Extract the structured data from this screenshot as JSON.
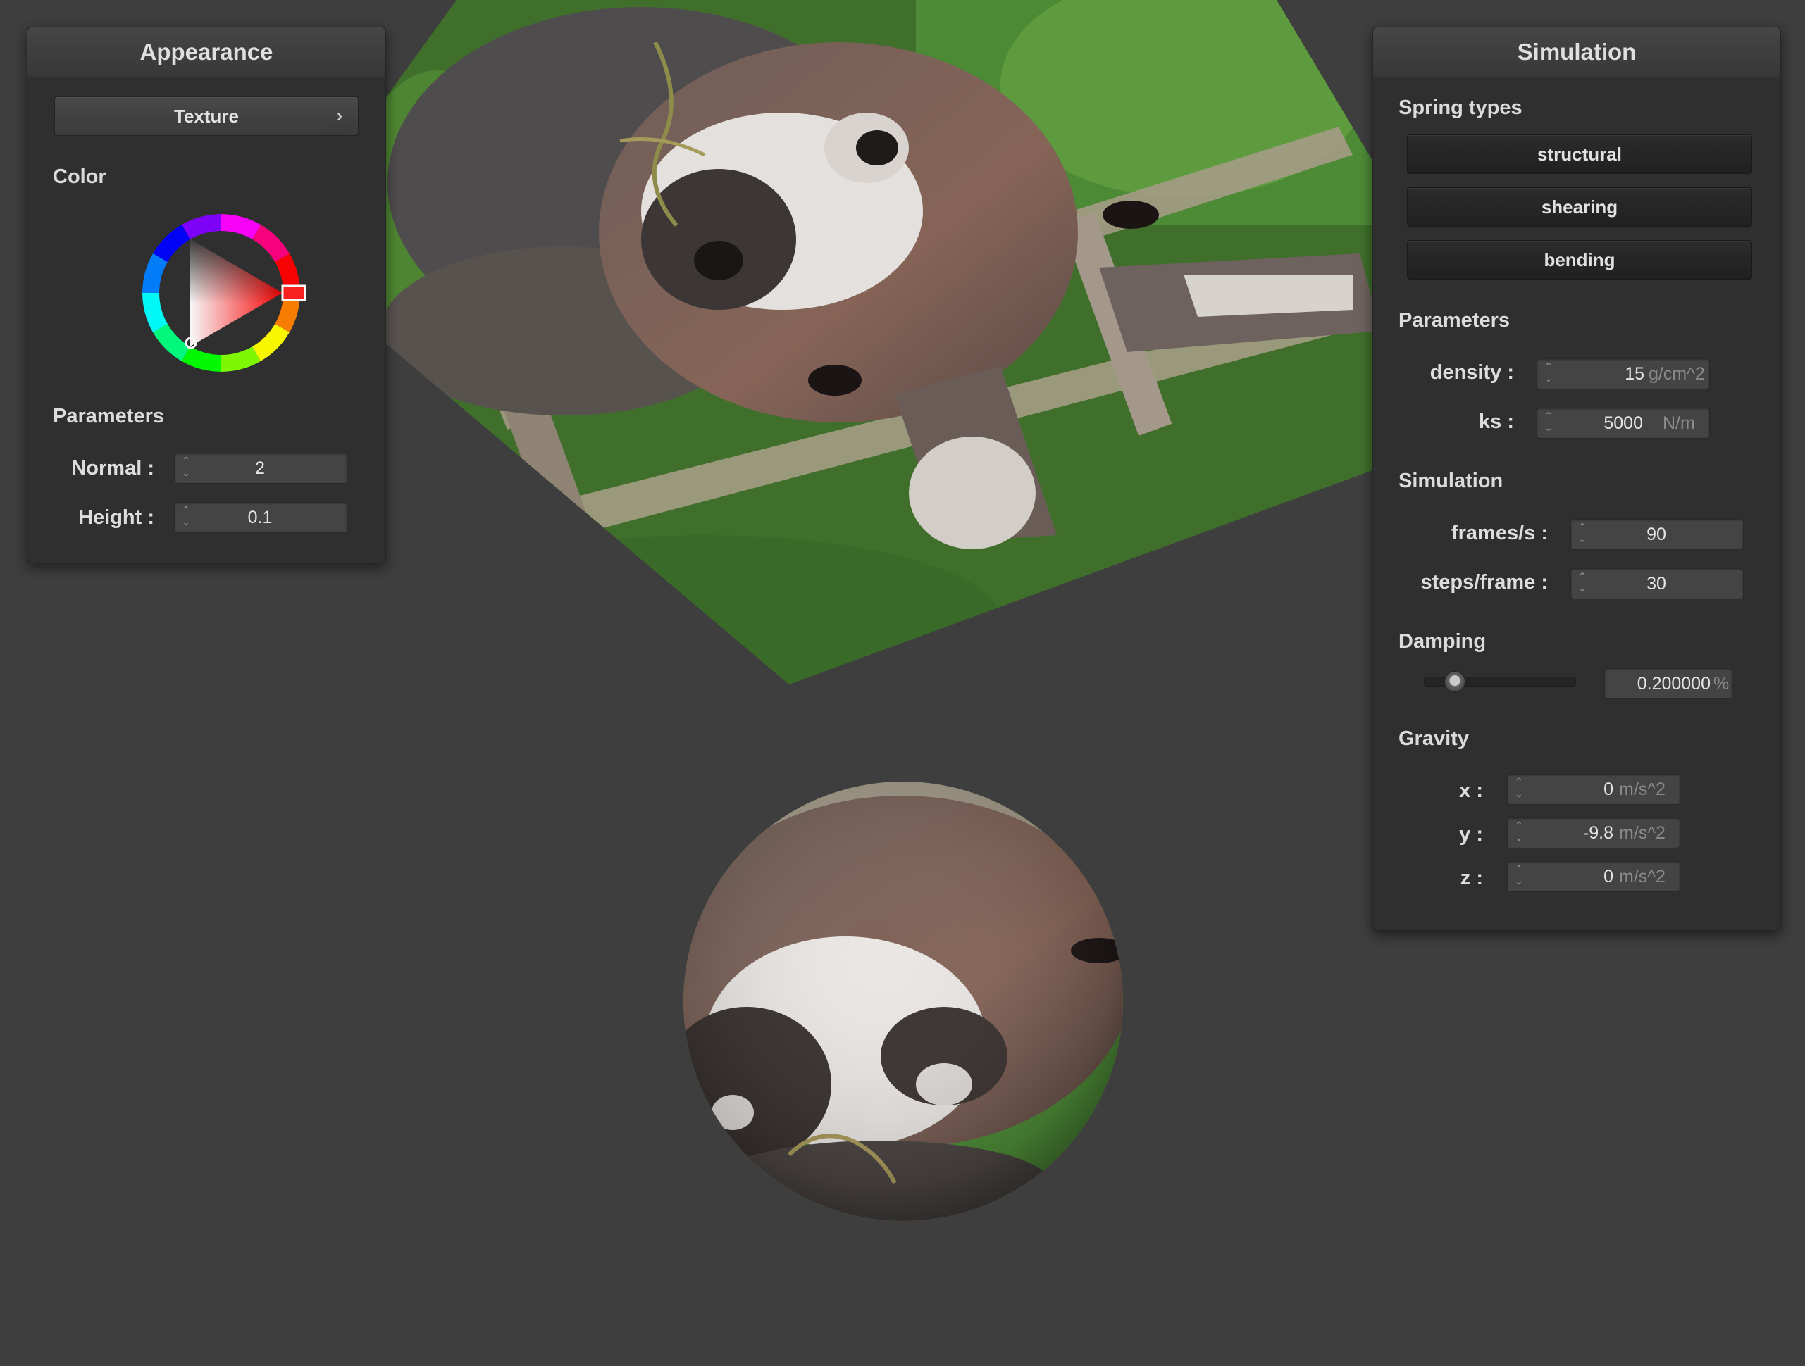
{
  "appearance": {
    "title": "Appearance",
    "texture_label": "Texture",
    "color_label": "Color",
    "params_title": "Parameters",
    "normal_label": "Normal :",
    "normal_value": "2",
    "height_label": "Height :",
    "height_value": "0.1",
    "picked_color": "#ff0000"
  },
  "simulation": {
    "title": "Simulation",
    "spring_types_title": "Spring types",
    "spring_types": [
      "structural",
      "shearing",
      "bending"
    ],
    "params_title": "Parameters",
    "density_label": "density :",
    "density_value": "15",
    "density_unit": "g/cm^2",
    "ks_label": "ks :",
    "ks_value": "5000",
    "ks_unit": "N/m",
    "sim_title": "Simulation",
    "fps_label": "frames/s :",
    "fps_value": "90",
    "steps_label": "steps/frame :",
    "steps_value": "30",
    "damping_title": "Damping",
    "damping_value": "0.200000",
    "damping_unit": "%",
    "damping_fraction": 0.2,
    "gravity_title": "Gravity",
    "gx_label": "x :",
    "gx_value": "0",
    "gy_label": "y :",
    "gy_value": "-9.8",
    "gz_label": "z :",
    "gz_value": "0",
    "gravity_unit": "m/s^2"
  },
  "scene": {
    "cloth_texture": "donkey-photo",
    "sphere_texture": "donkey-photo"
  }
}
